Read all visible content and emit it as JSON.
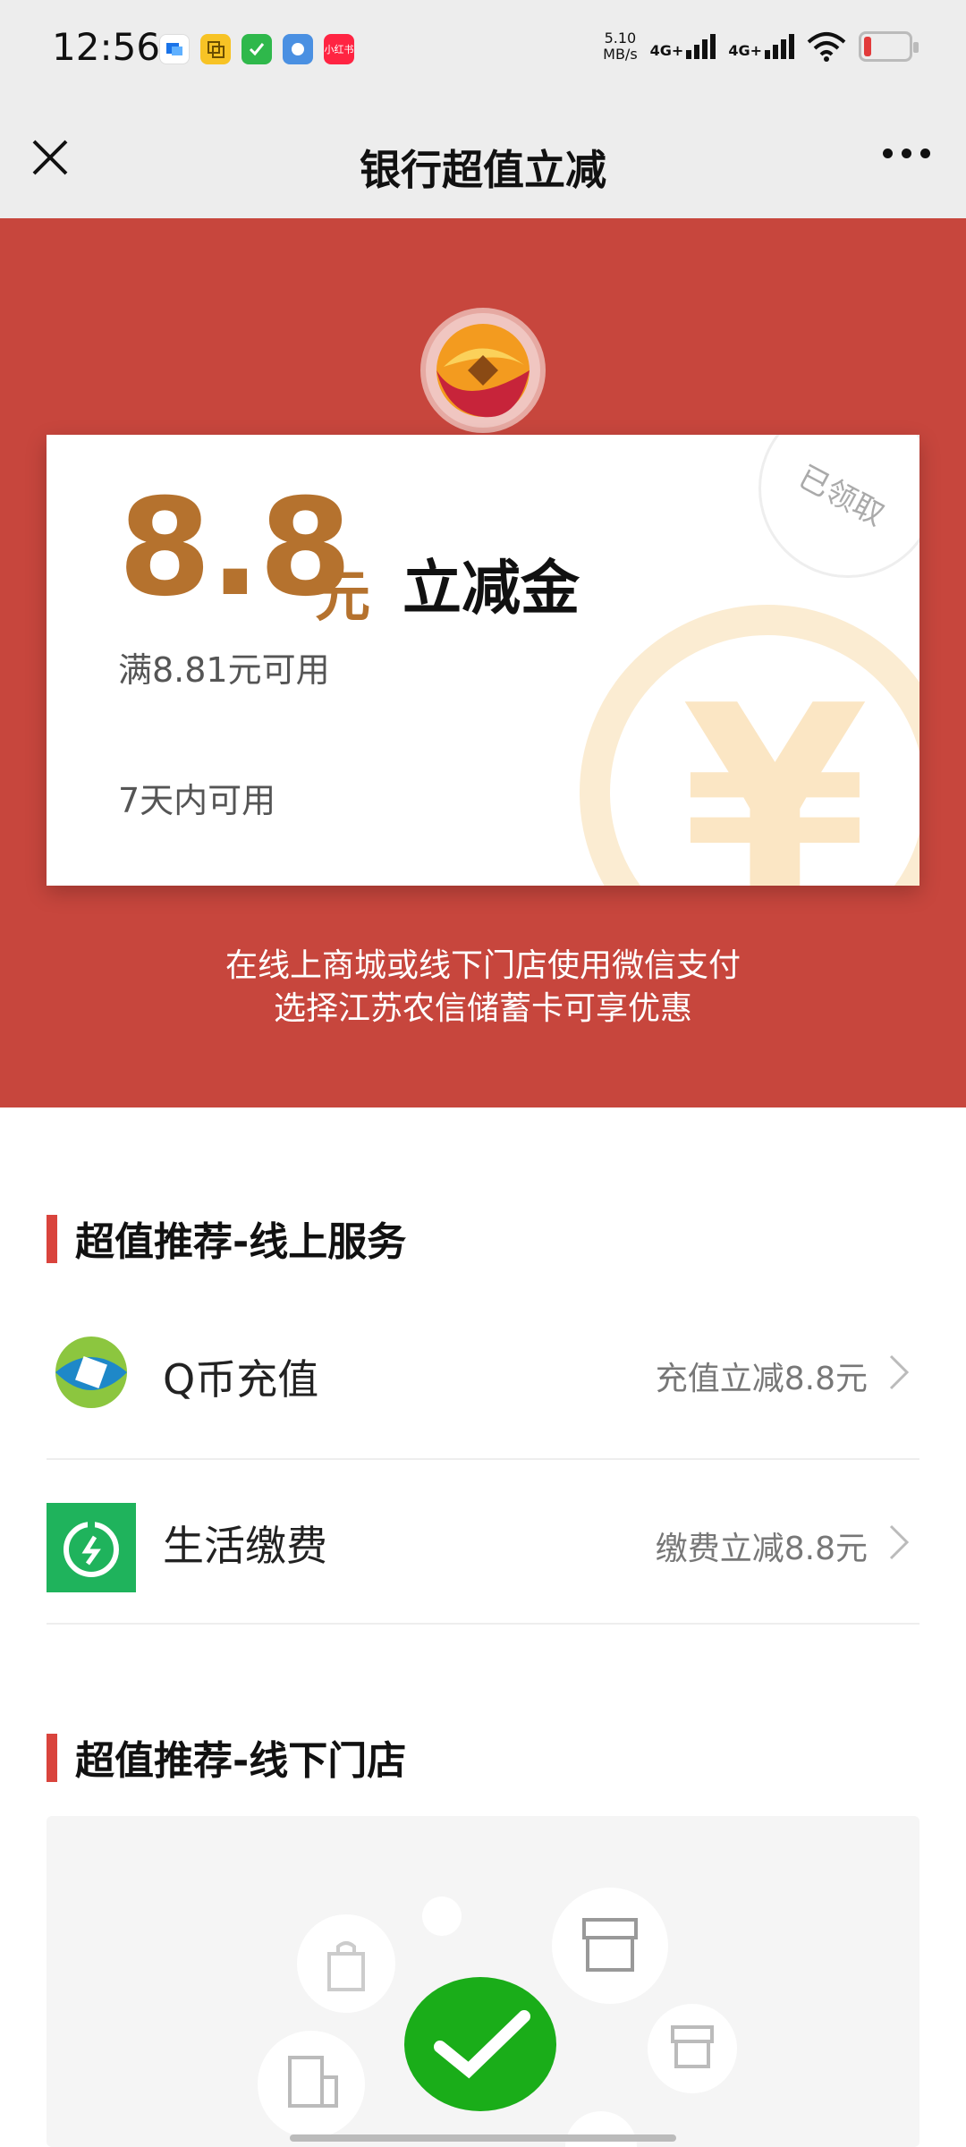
{
  "status_bar": {
    "time": "12:56",
    "net_speed_top": "5.10",
    "net_speed_bottom": "MB/s",
    "signal1": "4G+",
    "signal2": "4G+",
    "app_badge": "小红书"
  },
  "nav": {
    "title": "银行超值立减"
  },
  "coupon": {
    "amount": "8.8",
    "unit": "元",
    "label": "立减金",
    "condition": "满8.81元可用",
    "validity": "7天内可用",
    "stamp": "已领取",
    "currency_symbol": "¥"
  },
  "hero_desc": {
    "line1": "在线上商城或线下门店使用微信支付",
    "line2": "选择江苏农信储蓄卡可享优惠"
  },
  "section_online": {
    "title": "超值推荐-线上服务",
    "items": [
      {
        "name": "Q币充值",
        "offer": "充值立减8.8元"
      },
      {
        "name": "生活缴费",
        "offer": "缴费立减8.8元"
      }
    ]
  },
  "section_offline": {
    "title": "超值推荐-线下门店"
  },
  "colors": {
    "hero_red": "#c7463d",
    "amount_gold": "#b5722e",
    "wechat_green": "#1aad19"
  }
}
